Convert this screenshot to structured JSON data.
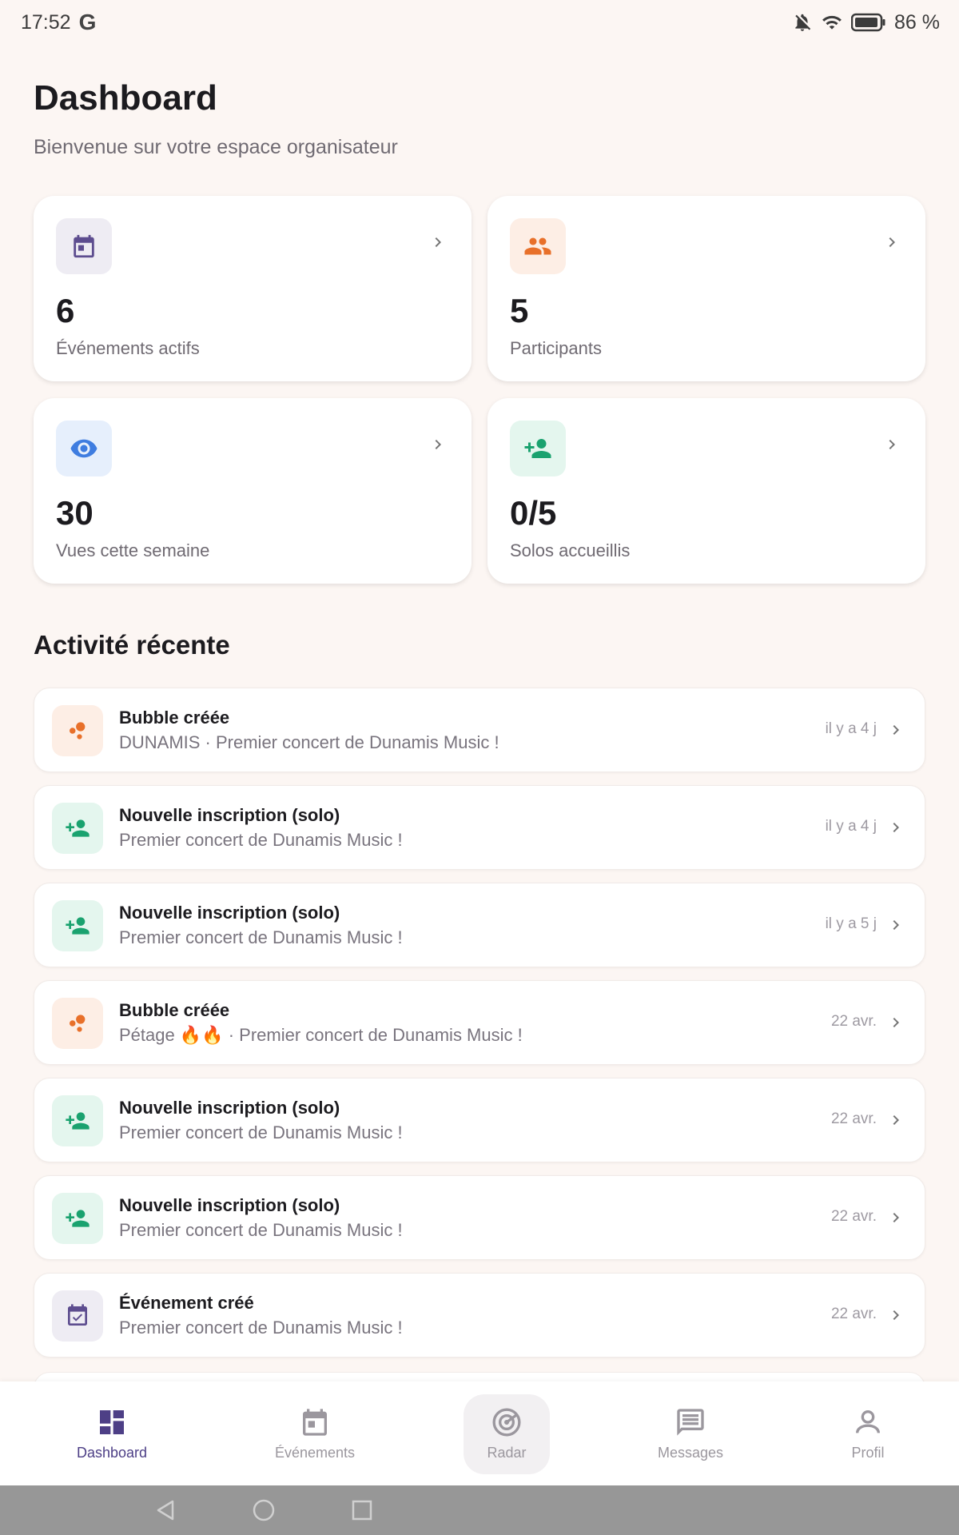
{
  "status_bar": {
    "time": "17:52",
    "carrier_logo": "G",
    "battery": "86 %"
  },
  "header": {
    "title": "Dashboard",
    "subtitle": "Bienvenue sur votre espace organisateur"
  },
  "stats": [
    {
      "value": "6",
      "label": "Événements actifs",
      "icon": "calendar-icon",
      "color": "#5d4d8f",
      "bg": "#eeecf3"
    },
    {
      "value": "5",
      "label": "Participants",
      "icon": "group-icon",
      "color": "#e8702a",
      "bg": "#fdeee5"
    },
    {
      "value": "30",
      "label": "Vues cette semaine",
      "icon": "eye-icon",
      "color": "#3f7de0",
      "bg": "#e6effc"
    },
    {
      "value": "0/5",
      "label": "Solos accueillis",
      "icon": "person-add-icon",
      "color": "#1aa26f",
      "bg": "#e4f6ee"
    }
  ],
  "recent": {
    "title": "Activité récente",
    "items": [
      {
        "type": "bubble",
        "title": "Bubble créée",
        "subtitle": "DUNAMIS · Premier concert de Dunamis Music !",
        "time": "il y a 4 j"
      },
      {
        "type": "solo",
        "title": "Nouvelle inscription (solo)",
        "subtitle": "Premier concert de Dunamis Music !",
        "time": "il y a 4 j"
      },
      {
        "type": "solo",
        "title": "Nouvelle inscription (solo)",
        "subtitle": "Premier concert de Dunamis Music !",
        "time": "il y a 5 j"
      },
      {
        "type": "bubble",
        "title": "Bubble créée",
        "subtitle": "Pétage 🔥🔥 · Premier concert de Dunamis Music !",
        "time": "22 avr."
      },
      {
        "type": "solo",
        "title": "Nouvelle inscription (solo)",
        "subtitle": "Premier concert de Dunamis Music !",
        "time": "22 avr."
      },
      {
        "type": "solo",
        "title": "Nouvelle inscription (solo)",
        "subtitle": "Premier concert de Dunamis Music !",
        "time": "22 avr."
      },
      {
        "type": "event",
        "title": "Événement créé",
        "subtitle": "Premier concert de Dunamis Music !",
        "time": "22 avr."
      }
    ]
  },
  "nav": {
    "items": [
      {
        "label": "Dashboard",
        "icon": "dashboard-icon",
        "active": true
      },
      {
        "label": "Événements",
        "icon": "calendar-icon",
        "active": false
      },
      {
        "label": "Radar",
        "icon": "radar-icon",
        "active": false
      },
      {
        "label": "Messages",
        "icon": "message-icon",
        "active": false
      },
      {
        "label": "Profil",
        "icon": "profile-icon",
        "active": false
      }
    ]
  },
  "colors": {
    "accent": "#4d3f86",
    "bubble_icon": "#e8702a",
    "bubble_bg": "#fdeee5",
    "solo_icon": "#1aa26f",
    "solo_bg": "#e4f6ee",
    "event_icon": "#5d4d8f",
    "event_bg": "#eeecf3"
  }
}
